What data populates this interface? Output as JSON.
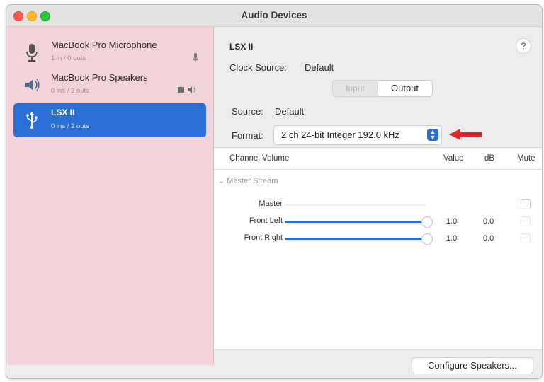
{
  "window": {
    "title": "Audio Devices"
  },
  "sidebar": {
    "devices": [
      {
        "name": "MacBook Pro Microphone",
        "io": "1 in / 0 outs",
        "icon": "microphone-icon",
        "accessory": "microphone-small-icon"
      },
      {
        "name": "MacBook Pro Speakers",
        "io": "0 ins / 2 outs",
        "icon": "speaker-icon",
        "accessory": "speaker-small-icon"
      },
      {
        "name": "LSX II",
        "io": "0 ins / 2 outs",
        "icon": "usb-icon",
        "selected": true
      }
    ],
    "bottom_bar": {
      "add": "+",
      "remove": "−",
      "gear": "⚙",
      "chevron": "⌄"
    }
  },
  "main": {
    "device_title": "LSX II",
    "help": "?",
    "clock_source_label": "Clock Source:",
    "clock_source_value": "Default",
    "tabs": [
      {
        "label": "Input",
        "active": false
      },
      {
        "label": "Output",
        "active": true
      }
    ],
    "source_label": "Source:",
    "source_value": "Default",
    "format_label": "Format:",
    "format_value": "2 ch 24-bit Integer 192.0 kHz",
    "annotation_arrow_color": "#e0262a",
    "table": {
      "headers": {
        "channel": "Channel Volume",
        "value": "Value",
        "db": "dB",
        "mute": "Mute"
      },
      "group": "Master Stream",
      "rows": [
        {
          "label": "Master",
          "level": null,
          "value": "",
          "db": ""
        },
        {
          "label": "Front Left",
          "level": 1.0,
          "value": "1.0",
          "db": "0.0"
        },
        {
          "label": "Front Right",
          "level": 1.0,
          "value": "1.0",
          "db": "0.0"
        }
      ]
    },
    "configure_button": "Configure Speakers..."
  },
  "colors": {
    "accent": "#2b6fd6",
    "sidebar_bg": "#f1d3d9"
  }
}
